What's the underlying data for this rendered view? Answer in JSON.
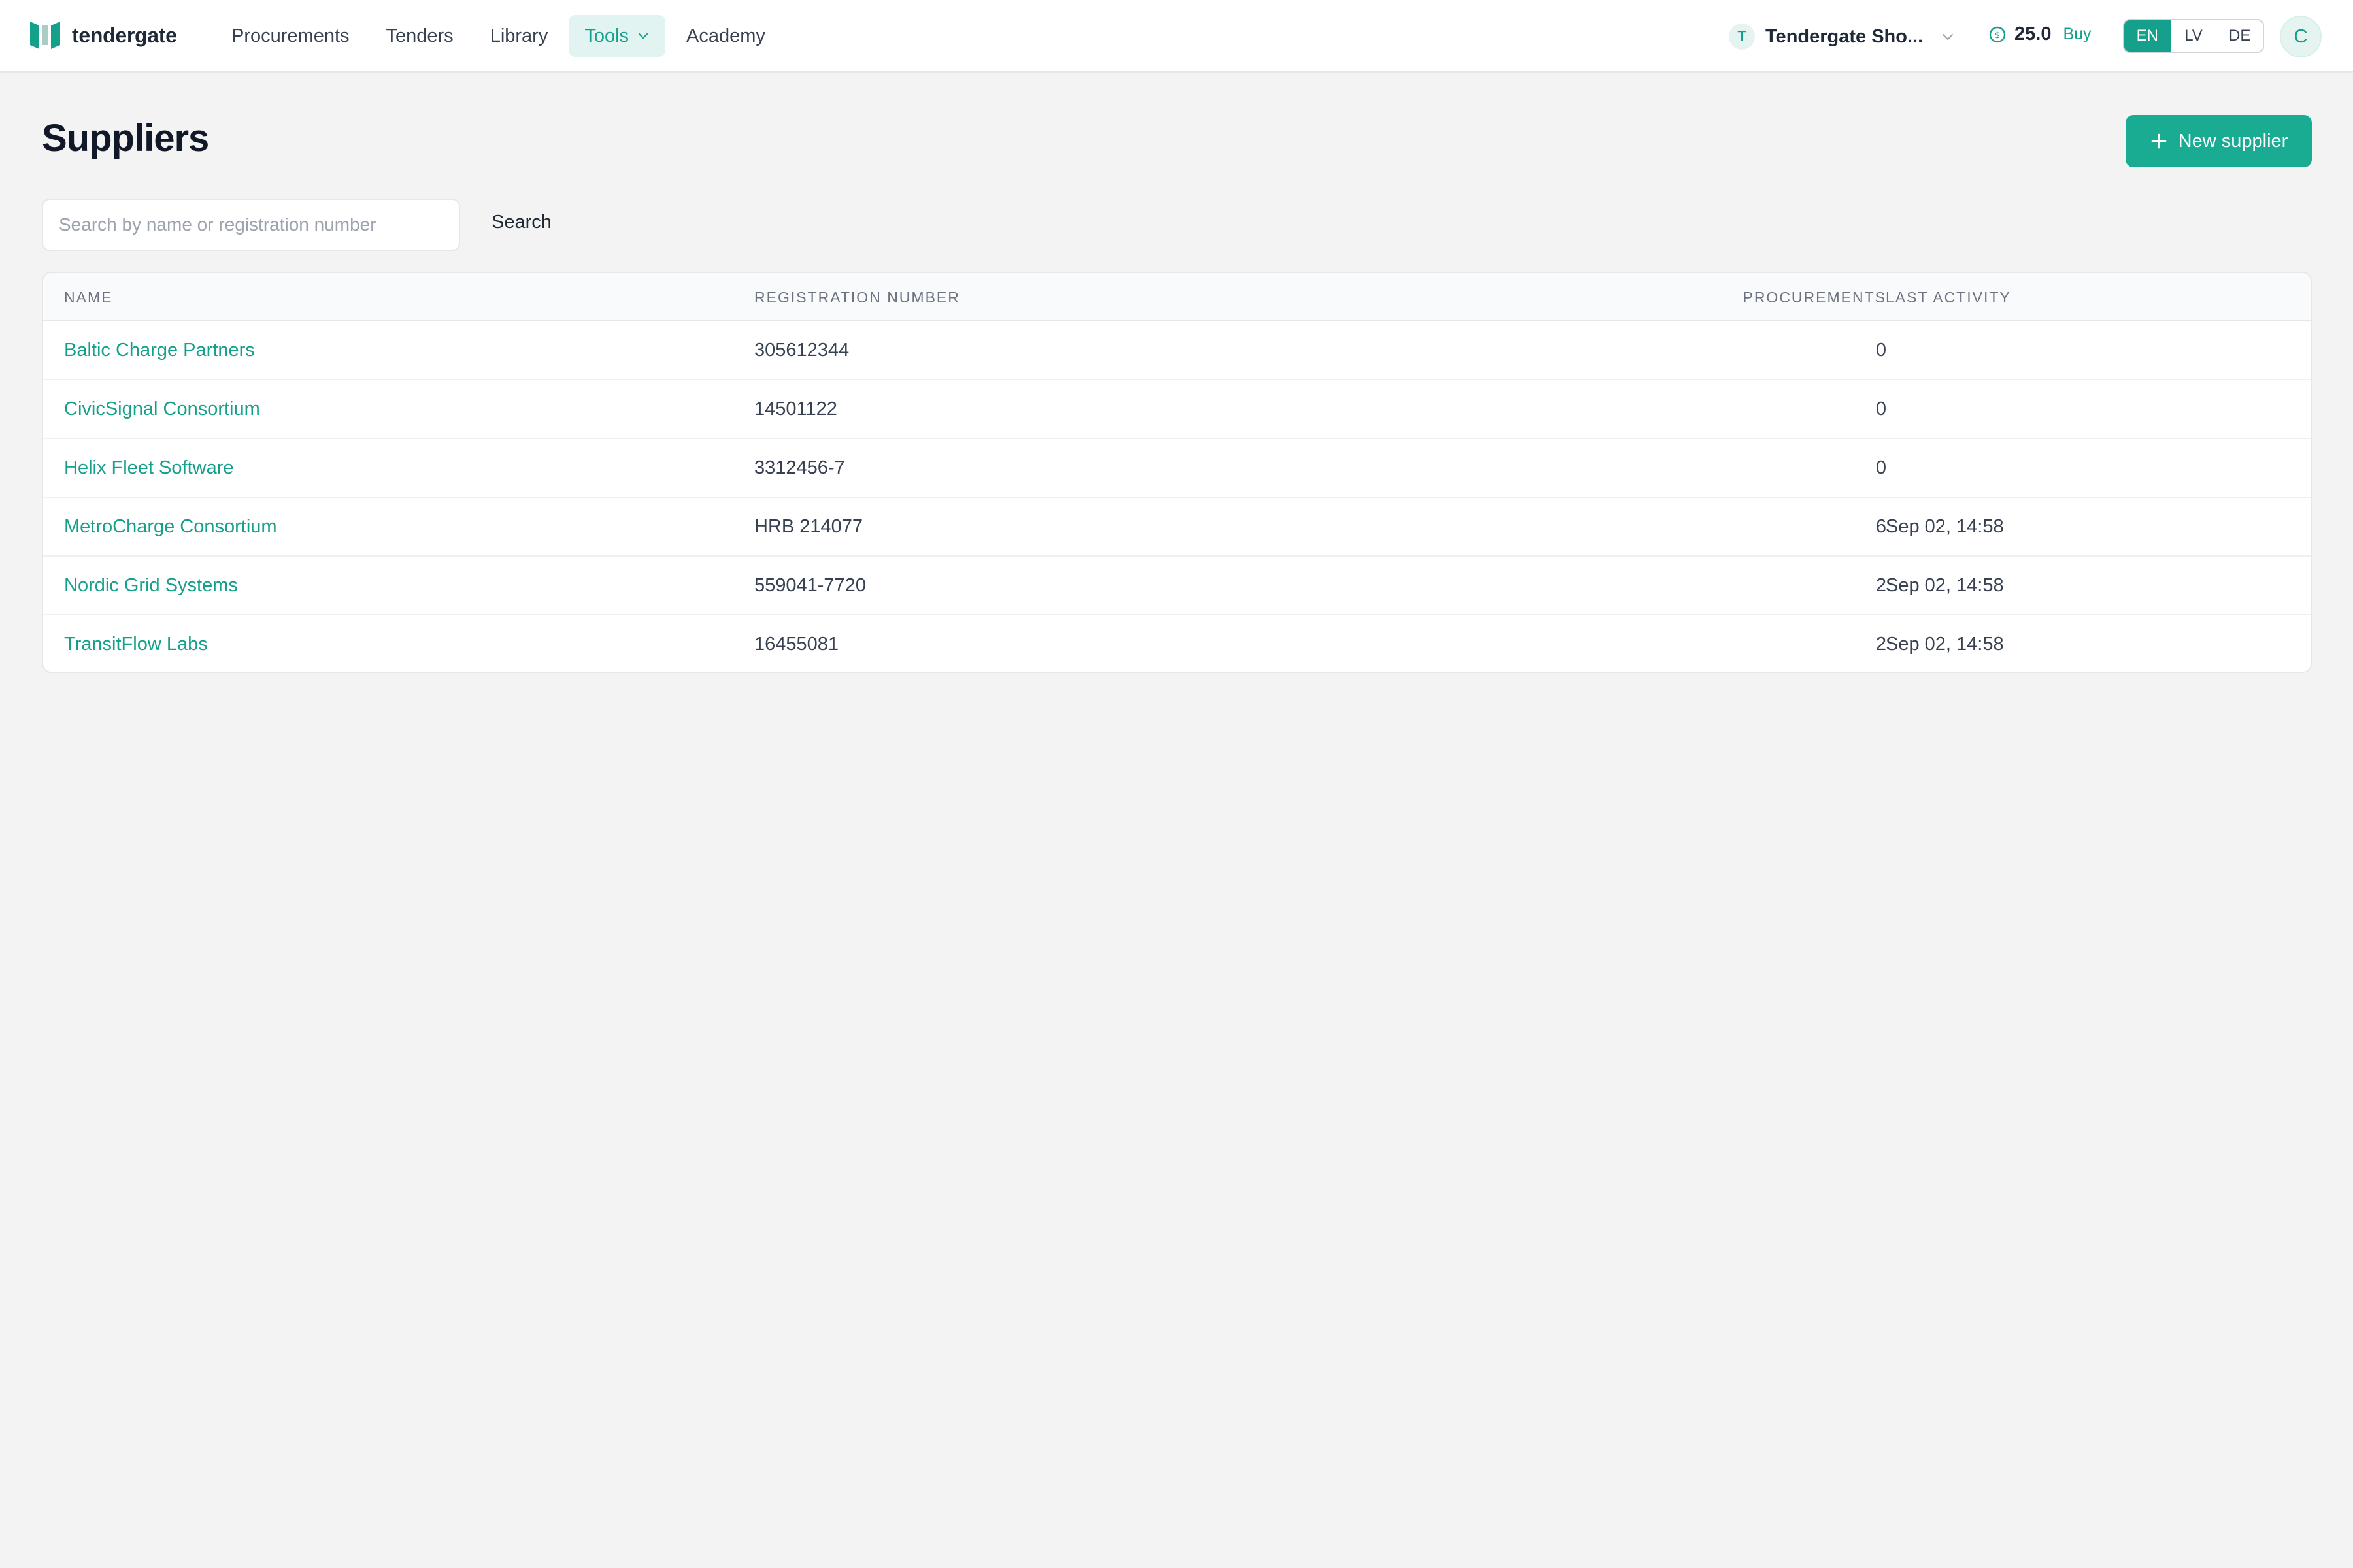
{
  "brand": {
    "name": "tendergate",
    "accent": "#14a08a"
  },
  "nav": {
    "items": [
      {
        "label": "Procurements"
      },
      {
        "label": "Tenders"
      },
      {
        "label": "Library"
      },
      {
        "label": "Tools"
      },
      {
        "label": "Academy"
      }
    ]
  },
  "org": {
    "initial": "T",
    "name": "Tendergate Sho..."
  },
  "credits": {
    "value": "25.0",
    "buy_label": "Buy"
  },
  "languages": [
    {
      "code": "EN"
    },
    {
      "code": "LV"
    },
    {
      "code": "DE"
    }
  ],
  "user": {
    "initial": "C"
  },
  "page": {
    "title": "Suppliers",
    "new_button_label": "New supplier"
  },
  "search": {
    "placeholder": "Search by name or registration number",
    "value": "",
    "button_label": "Search"
  },
  "table": {
    "columns": {
      "name": "Name",
      "registration_number": "Registration number",
      "procurements": "Procurements",
      "last_activity": "Last activity"
    },
    "rows": [
      {
        "name": "Baltic Charge Partners",
        "registration_number": "305612344",
        "procurements": "0",
        "last_activity": ""
      },
      {
        "name": "CivicSignal Consortium",
        "registration_number": "14501122",
        "procurements": "0",
        "last_activity": ""
      },
      {
        "name": "Helix Fleet Software",
        "registration_number": "3312456-7",
        "procurements": "0",
        "last_activity": ""
      },
      {
        "name": "MetroCharge Consortium",
        "registration_number": "HRB 214077",
        "procurements": "6",
        "last_activity": "Sep 02, 14:58"
      },
      {
        "name": "Nordic Grid Systems",
        "registration_number": "559041-7720",
        "procurements": "2",
        "last_activity": "Sep 02, 14:58"
      },
      {
        "name": "TransitFlow Labs",
        "registration_number": "16455081",
        "procurements": "2",
        "last_activity": "Sep 02, 14:58"
      }
    ]
  }
}
